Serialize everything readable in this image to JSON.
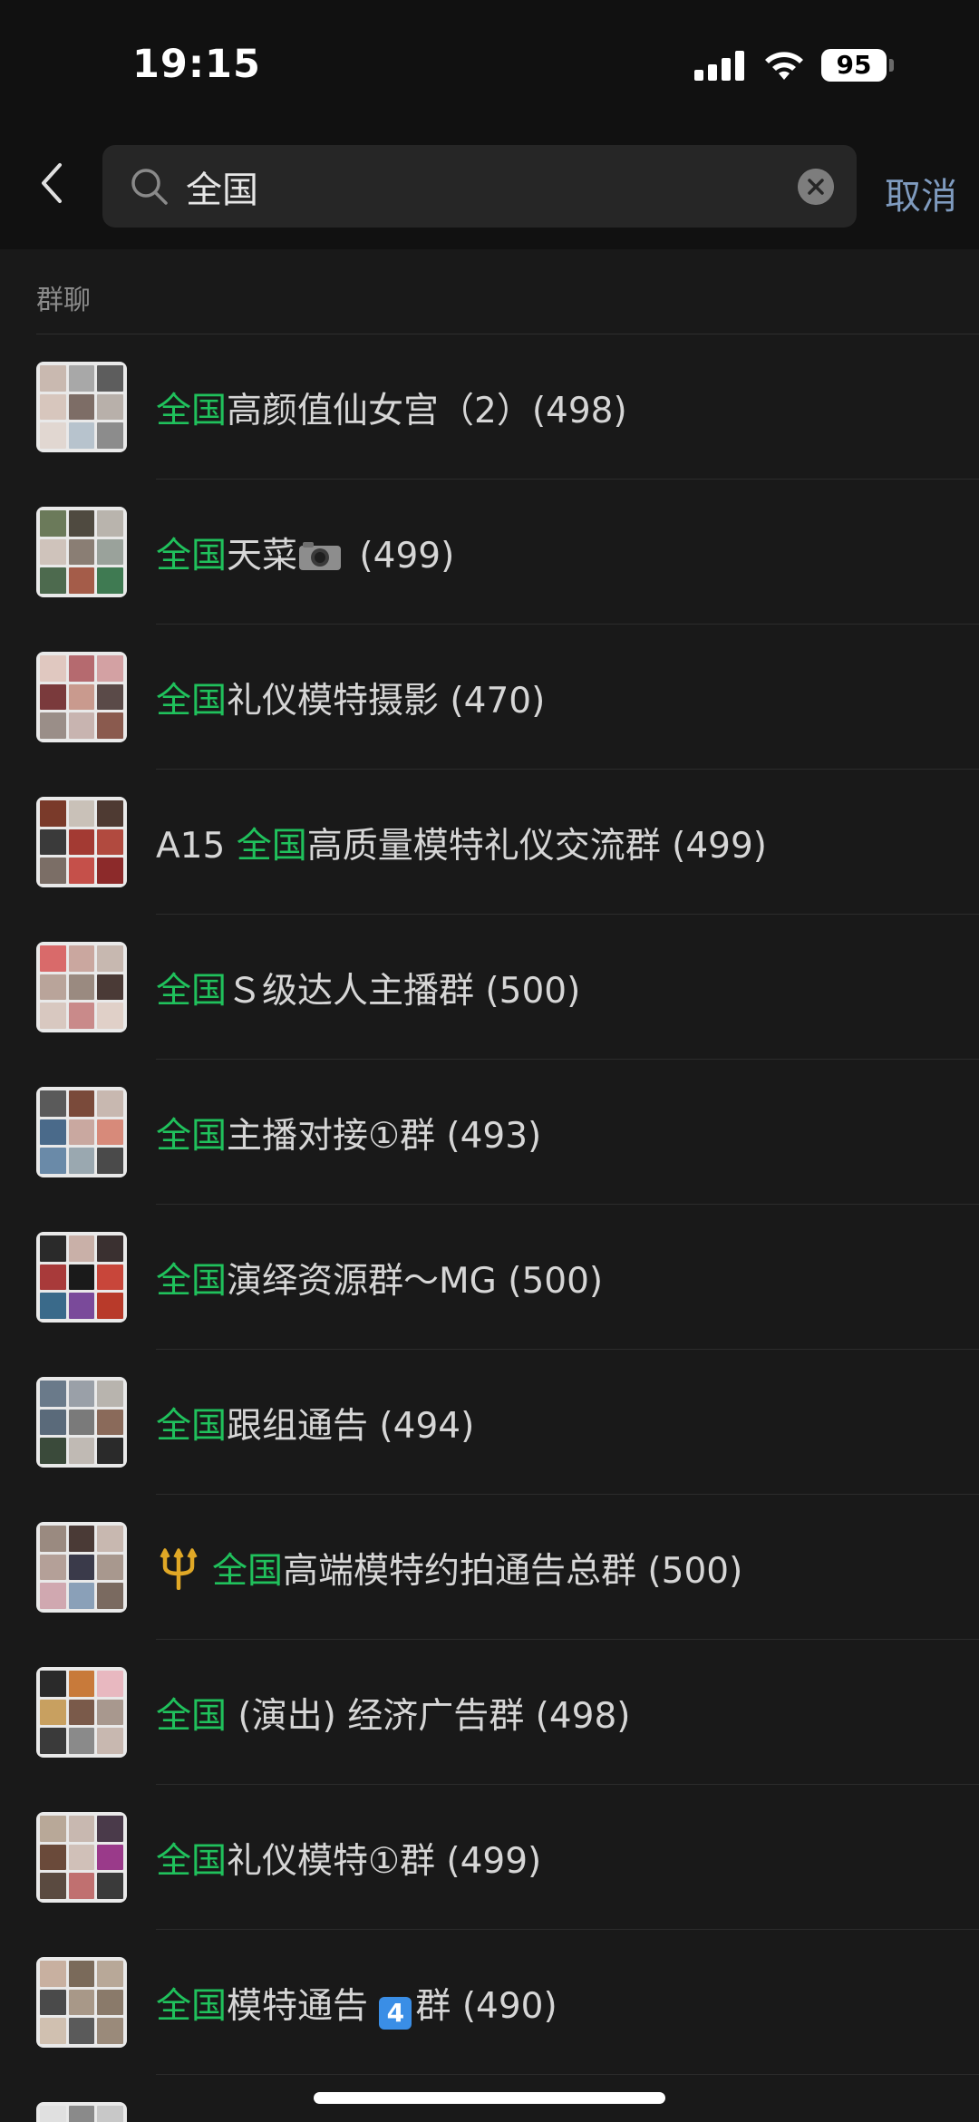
{
  "status_bar": {
    "time": "19:15",
    "battery": "95"
  },
  "search": {
    "query": "全国",
    "cancel_label": "取消"
  },
  "section": {
    "title": "群聊"
  },
  "results": [
    {
      "highlight": "全国",
      "text": "高颜值仙女宫（2）(498)"
    },
    {
      "highlight": "全国",
      "text": "天菜",
      "text_after_icon": " (499)"
    },
    {
      "highlight": "全国",
      "text": "礼仪模特摄影 (470)"
    },
    {
      "prefix": "A15 ",
      "highlight": "全国",
      "text": "高质量模特礼仪交流群 (499)"
    },
    {
      "highlight": "全国",
      "text": "Ｓ级达人主播群 (500)"
    },
    {
      "highlight": "全国",
      "text": "主播对接①群 (493)"
    },
    {
      "highlight": "全国",
      "text": "演绎资源群～MG (500)"
    },
    {
      "highlight": "全国",
      "text": "跟组通告 (494)"
    },
    {
      "highlight": "全国",
      "text": "高端模特约拍通告总群 (500)"
    },
    {
      "highlight": "全国",
      "text": " (演出) 经济广告群 (498)"
    },
    {
      "highlight": "全国",
      "text": "礼仪模特①群 (499)"
    },
    {
      "highlight": "全国",
      "text": "模特通告 ",
      "badge": "4",
      "text_after_icon": "群 (490)"
    }
  ],
  "colors": {
    "highlight": "#20c15c",
    "cancel": "#7f9bbf",
    "background": "#191919"
  }
}
